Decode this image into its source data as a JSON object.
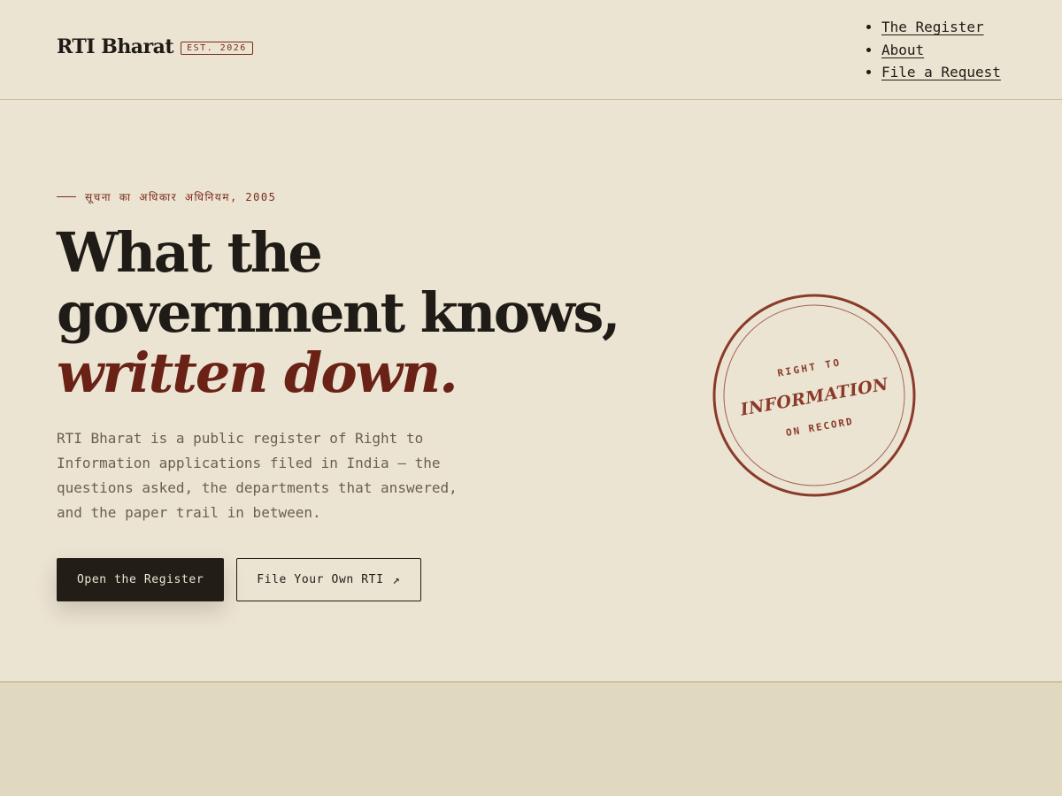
{
  "header": {
    "brand_name": "RTI Bharat",
    "brand_badge": "EST. 2026",
    "nav": [
      {
        "label": "The Register"
      },
      {
        "label": "About"
      },
      {
        "label": "File a Request"
      }
    ]
  },
  "hero": {
    "eyebrow": "सूचना का अधिकार अधिनियम, 2005",
    "headline_plain": "What the government knows,",
    "headline_accent": "written down.",
    "lede": "RTI Bharat is a public register of Right to Information applications filed in India — the questions asked, the departments that answered, and the paper trail in between.",
    "primary_cta": "Open the Register",
    "secondary_cta": "File Your Own RTI",
    "secondary_cta_icon": "arrow-up-right-icon",
    "stamp": {
      "top": "RIGHT TO",
      "middle": "INFORMATION",
      "bottom": "ON RECORD"
    }
  },
  "colors": {
    "background": "#ece4d2",
    "ink": "#1f1b16",
    "accent": "#7a2a1c",
    "muted": "#6a5f52"
  }
}
